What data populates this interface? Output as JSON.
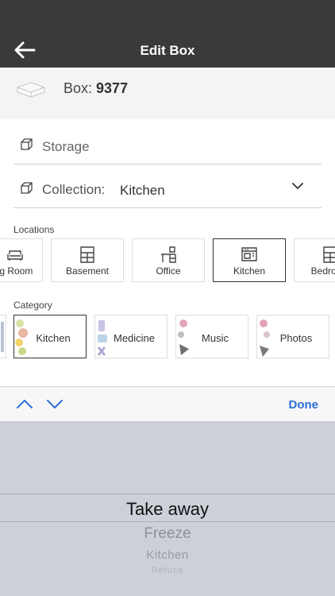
{
  "header": {
    "title": "Edit Box"
  },
  "box": {
    "prefix": "Box: ",
    "number": "9377"
  },
  "form": {
    "storage_placeholder": "Storage",
    "collection_label": "Collection:",
    "collection_value": "Kitchen"
  },
  "locations": {
    "title": "Locations",
    "items": [
      {
        "label": "Living Room",
        "icon": "sofa-icon"
      },
      {
        "label": "Basement",
        "icon": "shelf-icon"
      },
      {
        "label": "Office",
        "icon": "desk-icon"
      },
      {
        "label": "Kitchen",
        "icon": "stove-icon",
        "selected": true
      },
      {
        "label": "Bedroom",
        "icon": "bed-icon"
      }
    ]
  },
  "category": {
    "title": "Category",
    "items": [
      {
        "label": "Kitchen",
        "selected": true
      },
      {
        "label": "Medicine"
      },
      {
        "label": "Music"
      },
      {
        "label": "Photos"
      }
    ]
  },
  "toolbar": {
    "done_label": "Done"
  },
  "picker": {
    "selected": "Take away",
    "below": [
      "Freeze",
      "Kitchen",
      "Refuse"
    ]
  },
  "colors": {
    "header_bg": "#3a3a3a",
    "accent": "#2a6fd6",
    "picker_bg": "#ccd0d8"
  }
}
